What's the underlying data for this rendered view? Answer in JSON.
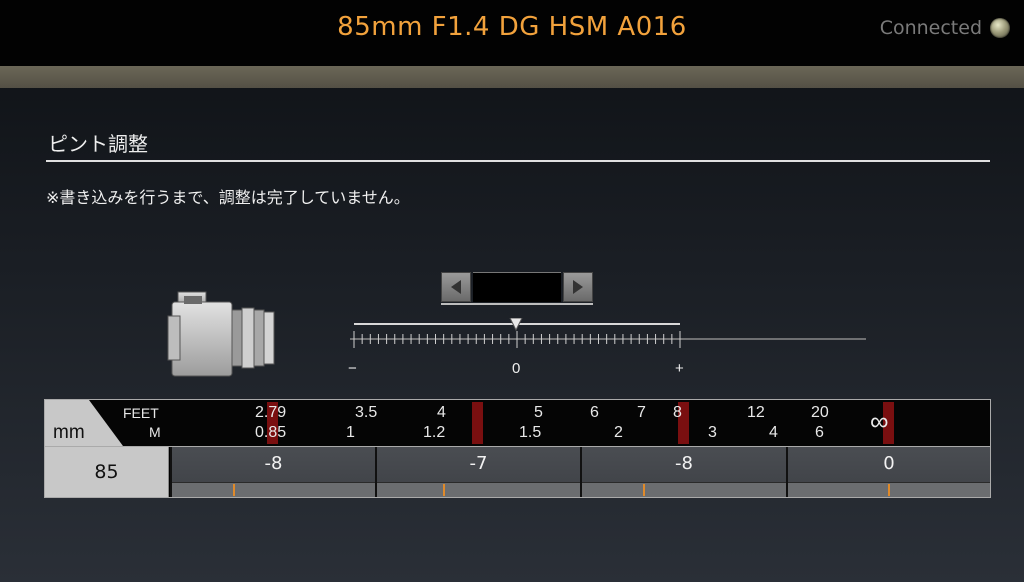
{
  "header": {
    "lens_name": "85mm F1.4 DG HSM A016",
    "status_label": "Connected"
  },
  "section": {
    "title": "ピント調整",
    "note": "※書き込みを行うまで、調整は完了していません。"
  },
  "scale": {
    "minus_label": "−",
    "zero_label": "0",
    "plus_label": "+"
  },
  "table": {
    "unit_label": "mm",
    "feet_label": "FEET",
    "m_label": "M",
    "feet_values": [
      "2.79",
      "3.5",
      "4",
      "5",
      "6",
      "7",
      "8",
      "12",
      "20"
    ],
    "m_values": [
      "0.85",
      "1",
      "1.2",
      "1.5",
      "2",
      "3",
      "4",
      "6"
    ],
    "infinity_label": "∞",
    "focal_length": "85",
    "adjustments": [
      "-8",
      "-7",
      "-8",
      "0"
    ]
  },
  "colors": {
    "title_orange": "#f2a23c",
    "distance_marker_red": "#7a0f10",
    "adjust_marker_orange": "#e08a2a"
  }
}
